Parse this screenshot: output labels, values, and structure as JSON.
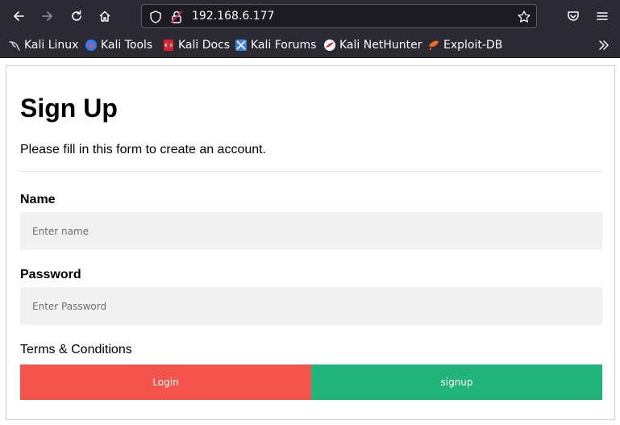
{
  "browser": {
    "url": "192.168.6.177",
    "bookmarks": [
      {
        "label": "Kali Linux",
        "icon": "kali-dragon-icon"
      },
      {
        "label": "Kali Tools",
        "icon": "kali-tools-icon"
      },
      {
        "label": "Kali Docs",
        "icon": "kali-docs-icon"
      },
      {
        "label": "Kali Forums",
        "icon": "kali-forums-icon"
      },
      {
        "label": "Kali NetHunter",
        "icon": "nethunter-icon"
      },
      {
        "label": "Exploit-DB",
        "icon": "exploit-db-icon"
      }
    ],
    "colors": {
      "chrome_bg": "#2b2a33",
      "urlbar_bg": "#1c1b22"
    }
  },
  "form": {
    "title": "Sign Up",
    "subtitle": "Please fill in this form to create an account.",
    "name_label": "Name",
    "name_placeholder": "Enter name",
    "password_label": "Password",
    "password_placeholder": "Enter Password",
    "terms_text": "Terms & Conditions",
    "login_label": "Login",
    "signup_label": "signup",
    "colors": {
      "login_bg": "#f4544c",
      "signup_bg": "#21b47b",
      "input_bg": "#f1f1f1"
    }
  }
}
